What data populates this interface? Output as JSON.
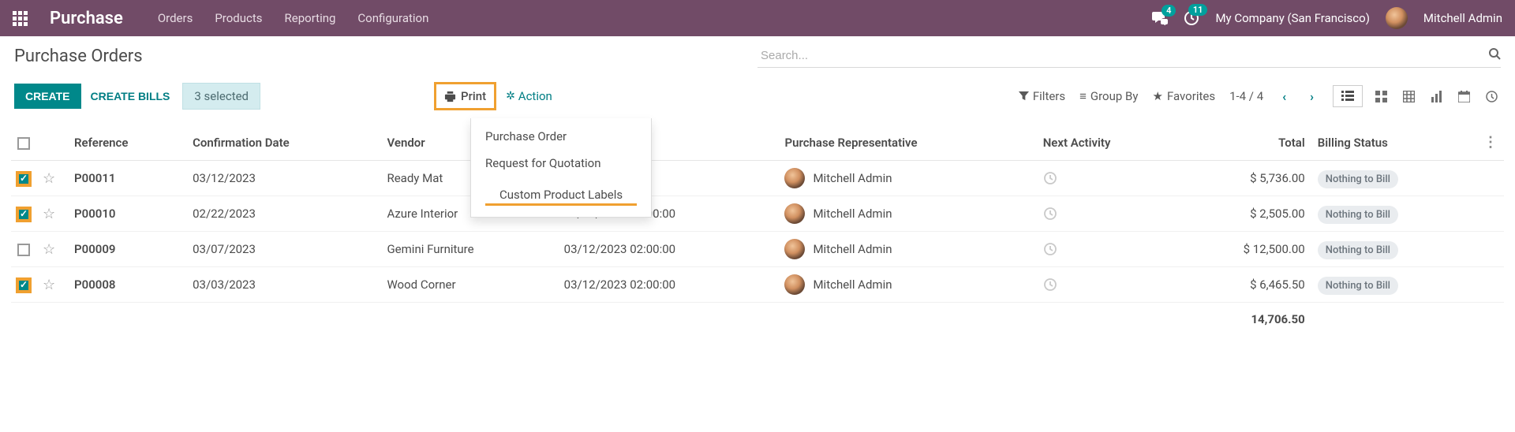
{
  "navbar": {
    "brand": "Purchase",
    "menus": [
      "Orders",
      "Products",
      "Reporting",
      "Configuration"
    ],
    "chat_badge": "4",
    "clock_badge": "11",
    "company": "My Company (San Francisco)",
    "user": "Mitchell Admin"
  },
  "title": "Purchase Orders",
  "search_placeholder": "Search...",
  "buttons": {
    "create": "CREATE",
    "create_bills": "CREATE BILLS",
    "selected": "3 selected",
    "print": "Print",
    "action": "Action",
    "filters": "Filters",
    "group_by": "Group By",
    "favorites": "Favorites"
  },
  "pager": "1-4 / 4",
  "print_menu": {
    "item1": "Purchase Order",
    "item2": "Request for Quotation",
    "item3": "Custom Product Labels"
  },
  "columns": {
    "reference": "Reference",
    "confirm_date": "Confirmation Date",
    "vendor": "Vendor",
    "rep": "Purchase Representative",
    "next": "Next Activity",
    "total": "Total",
    "billing": "Billing Status"
  },
  "rows": [
    {
      "checked": true,
      "ref": "P00011",
      "confirm": "03/12/2023",
      "vendor": "Ready Mat",
      "order_deadline": "",
      "rep": "Mitchell Admin",
      "total": "$ 5,736.00",
      "billing": "Nothing to Bill"
    },
    {
      "checked": true,
      "ref": "P00010",
      "confirm": "02/22/2023",
      "vendor": "Azure Interior",
      "order_deadline": "03/12/2023 02:00:00",
      "rep": "Mitchell Admin",
      "total": "$ 2,505.00",
      "billing": "Nothing to Bill"
    },
    {
      "checked": false,
      "ref": "P00009",
      "confirm": "03/07/2023",
      "vendor": "Gemini Furniture",
      "order_deadline": "03/12/2023 02:00:00",
      "rep": "Mitchell Admin",
      "total": "$ 12,500.00",
      "billing": "Nothing to Bill"
    },
    {
      "checked": true,
      "ref": "P00008",
      "confirm": "03/03/2023",
      "vendor": "Wood Corner",
      "order_deadline": "03/12/2023 02:00:00",
      "rep": "Mitchell Admin",
      "total": "$ 6,465.50",
      "billing": "Nothing to Bill"
    }
  ],
  "footer_total": "14,706.50"
}
